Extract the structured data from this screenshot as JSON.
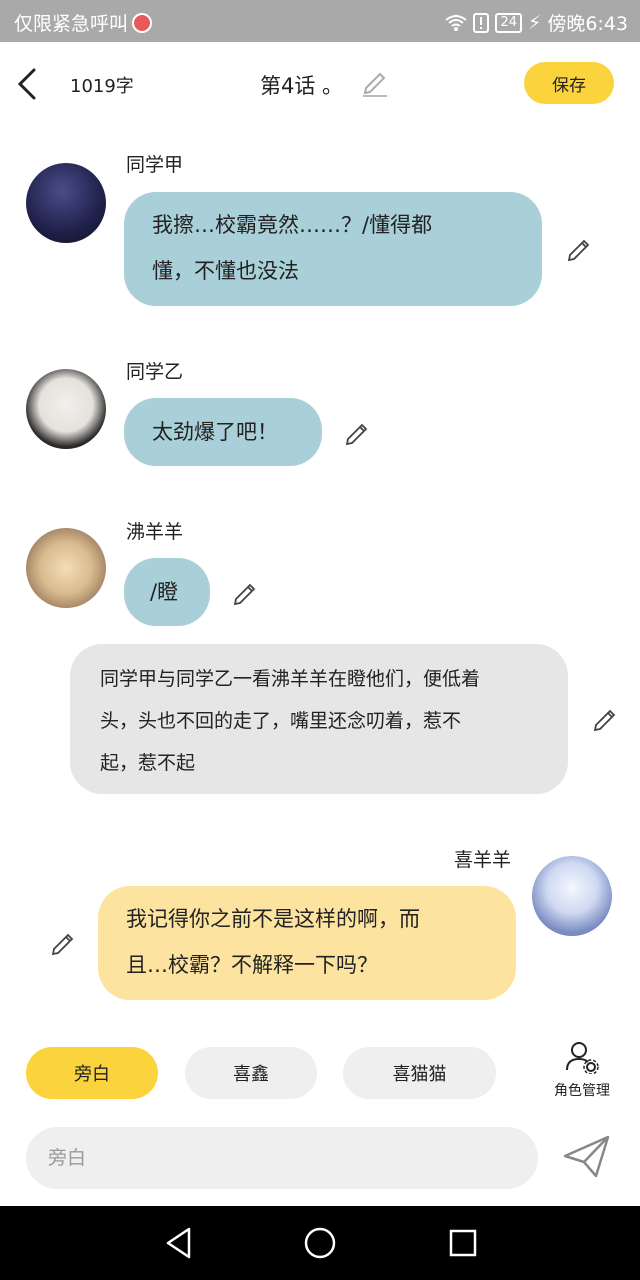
{
  "status_bar": {
    "left_text": "仅限紧急呼叫",
    "battery": "24",
    "time": "傍晚6:43"
  },
  "header": {
    "word_count": "1019字",
    "title": "第4话 。",
    "save_label": "保存"
  },
  "messages": [
    {
      "speaker": "同学甲",
      "text_line1": "我擦…校霸竟然……？/懂得都",
      "text_line2": "懂，不懂也没法"
    },
    {
      "speaker": "同学乙",
      "text": "太劲爆了吧！"
    },
    {
      "speaker": "沸羊羊",
      "text": "/瞪"
    },
    {
      "narration_line1": "同学甲与同学乙一看沸羊羊在瞪他们，便低着",
      "narration_line2": "头，头也不回的走了，嘴里还念叨着，惹不",
      "narration_line3": "起，惹不起"
    },
    {
      "speaker": "喜羊羊",
      "text_line1": "我记得你之前不是这样的啊，而",
      "text_line2": "且…校霸？不解释一下吗？"
    }
  ],
  "roles": {
    "items": [
      "旁白",
      "喜鑫",
      "喜猫猫"
    ],
    "manage_label": "角色管理"
  },
  "composer": {
    "placeholder": "旁白"
  },
  "colors": {
    "accent": "#fbd43d",
    "bubble_blue": "#a9cfd8",
    "bubble_yellow": "#fde3a0",
    "narration_grey": "#e6e6e6"
  }
}
